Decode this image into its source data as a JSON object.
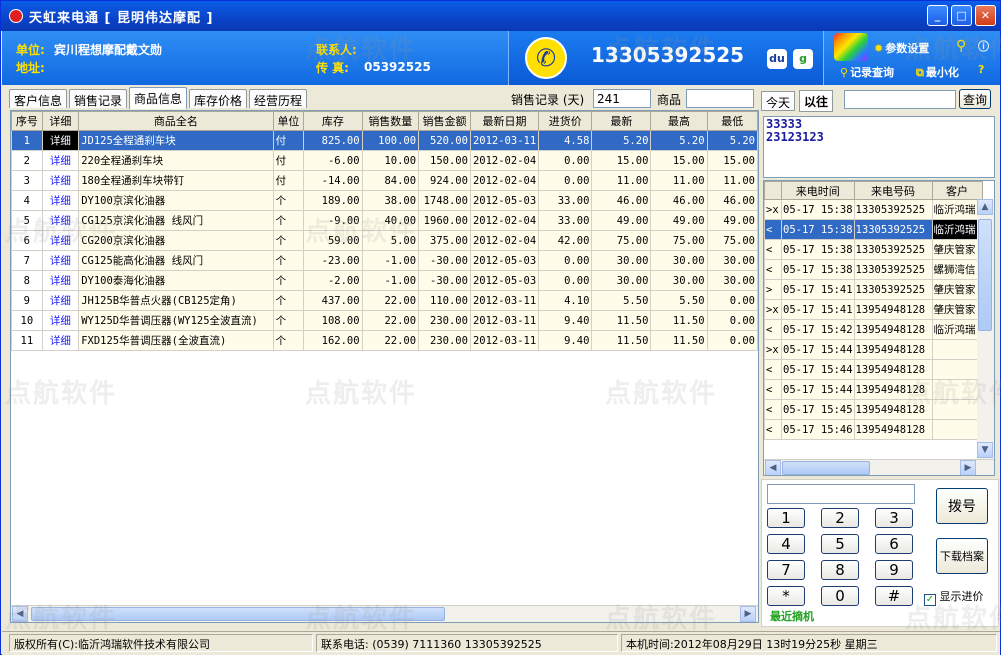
{
  "window": {
    "title": "天虹来电通 [ 昆明伟达摩配 ]"
  },
  "header": {
    "unit_label": "单位:",
    "unit_value": "宾川程想摩配戴文勋",
    "address_label": "地址:",
    "address_value": "",
    "contact_label": "联系人:",
    "contact_value": "",
    "fax_label": "传  真:",
    "fax_value": "05392525",
    "phone": "13305392525",
    "settings": "参数设置",
    "record_query": "记录查询",
    "minimize": "最小化"
  },
  "tabs": [
    "客户信息",
    "销售记录",
    "商品信息",
    "库存价格",
    "经营历程"
  ],
  "filters": {
    "sales_days_label": "销售记录 (天)",
    "sales_days_value": "241",
    "product_label": "商品",
    "product_value": ""
  },
  "product_table": {
    "columns": [
      "序号",
      "详细",
      "商品全名",
      "单位",
      "库存",
      "销售数量",
      "销售金额",
      "最新日期",
      "进货价",
      "最新",
      "最高",
      "最低"
    ],
    "rows": [
      [
        "1",
        "详细",
        "JD125全程通刹车块",
        "付",
        "825.00",
        "100.00",
        "520.00",
        "2012-03-11",
        "4.58",
        "5.20",
        "5.20",
        "5.20"
      ],
      [
        "2",
        "详细",
        "220全程通刹车块",
        "付",
        "-6.00",
        "10.00",
        "150.00",
        "2012-02-04",
        "0.00",
        "15.00",
        "15.00",
        "15.00"
      ],
      [
        "3",
        "详细",
        "180全程通刹车块带钉",
        "付",
        "-14.00",
        "84.00",
        "924.00",
        "2012-02-04",
        "0.00",
        "11.00",
        "11.00",
        "11.00"
      ],
      [
        "4",
        "详细",
        "DY100京滨化油器",
        "个",
        "189.00",
        "38.00",
        "1748.00",
        "2012-05-03",
        "33.00",
        "46.00",
        "46.00",
        "46.00"
      ],
      [
        "5",
        "详细",
        "CG125京滨化油器   线风门",
        "个",
        "-9.00",
        "40.00",
        "1960.00",
        "2012-02-04",
        "33.00",
        "49.00",
        "49.00",
        "49.00"
      ],
      [
        "6",
        "详细",
        "CG200京滨化油器",
        "个",
        "59.00",
        "5.00",
        "375.00",
        "2012-02-04",
        "42.00",
        "75.00",
        "75.00",
        "75.00"
      ],
      [
        "7",
        "详细",
        "CG125能高化油器   线风门",
        "个",
        "-23.00",
        "-1.00",
        "-30.00",
        "2012-05-03",
        "0.00",
        "30.00",
        "30.00",
        "30.00"
      ],
      [
        "8",
        "详细",
        "DY100泰海化油器",
        "个",
        "-2.00",
        "-1.00",
        "-30.00",
        "2012-05-03",
        "0.00",
        "30.00",
        "30.00",
        "30.00"
      ],
      [
        "9",
        "详细",
        "JH125B华普点火器(CB125定角)",
        "个",
        "437.00",
        "22.00",
        "110.00",
        "2012-03-11",
        "4.10",
        "5.50",
        "5.50",
        "0.00"
      ],
      [
        "10",
        "详细",
        "WY125D华普调压器(WY125全波直流)",
        "个",
        "108.00",
        "22.00",
        "230.00",
        "2012-03-11",
        "9.40",
        "11.50",
        "11.50",
        "0.00"
      ],
      [
        "11",
        "详细",
        "FXD125华普调压器(全波直流)",
        "个",
        "162.00",
        "22.00",
        "230.00",
        "2012-03-11",
        "9.40",
        "11.50",
        "11.50",
        "0.00"
      ]
    ]
  },
  "right": {
    "tab_today": "今天",
    "tab_past": "以往",
    "search_value": "",
    "query_button": "查询",
    "numbers": [
      "33333",
      "23123123"
    ]
  },
  "call_table": {
    "columns": [
      "",
      "来电时间",
      "来电号码",
      "客户"
    ],
    "rows": [
      [
        ">x",
        "05-17 15:38",
        "13305392525",
        "临沂鸿瑞"
      ],
      [
        "<",
        "05-17 15:38",
        "13305392525",
        "临沂鸿瑞"
      ],
      [
        "<",
        "05-17 15:38",
        "13305392525",
        "肇庆管家"
      ],
      [
        "<",
        "05-17 15:38",
        "13305392525",
        "螺狮湾信"
      ],
      [
        ">",
        "05-17 15:41",
        "13305392525",
        "肇庆管家"
      ],
      [
        ">x",
        "05-17 15:41",
        "13954948128",
        "肇庆管家"
      ],
      [
        "<",
        "05-17 15:42",
        "13954948128",
        "临沂鸿瑞"
      ],
      [
        ">x",
        "05-17 15:44",
        "13954948128",
        ""
      ],
      [
        "<",
        "05-17 15:44",
        "13954948128",
        ""
      ],
      [
        "<",
        "05-17 15:44",
        "13954948128",
        ""
      ],
      [
        "<",
        "05-17 15:45",
        "13954948128",
        ""
      ],
      [
        "<",
        "05-17 15:46",
        "13954948128",
        ""
      ]
    ]
  },
  "dialpad": {
    "input_value": "",
    "keys": [
      "1",
      "2",
      "3",
      "4",
      "5",
      "6",
      "7",
      "8",
      "9",
      "*",
      "0",
      "#"
    ],
    "dial_button": "拨号",
    "download_button": "下载档案",
    "show_cost_label": "显示进价",
    "recent_label": "最近摘机"
  },
  "status": {
    "copyright": "版权所有(C):临沂鸿瑞软件技术有限公司",
    "contact": "联系电话: (0539) 7111360 13305392525",
    "time": "本机时间:2012年08月29日 13时19分25秒 星期三"
  },
  "watermark": "点航软件",
  "colors": {
    "title_blue": "#0a5ee8",
    "header_blue": "#1169e0",
    "label_yellow": "#ffe100",
    "selection": "#316ac5",
    "row_yellow": "#fffde9"
  }
}
